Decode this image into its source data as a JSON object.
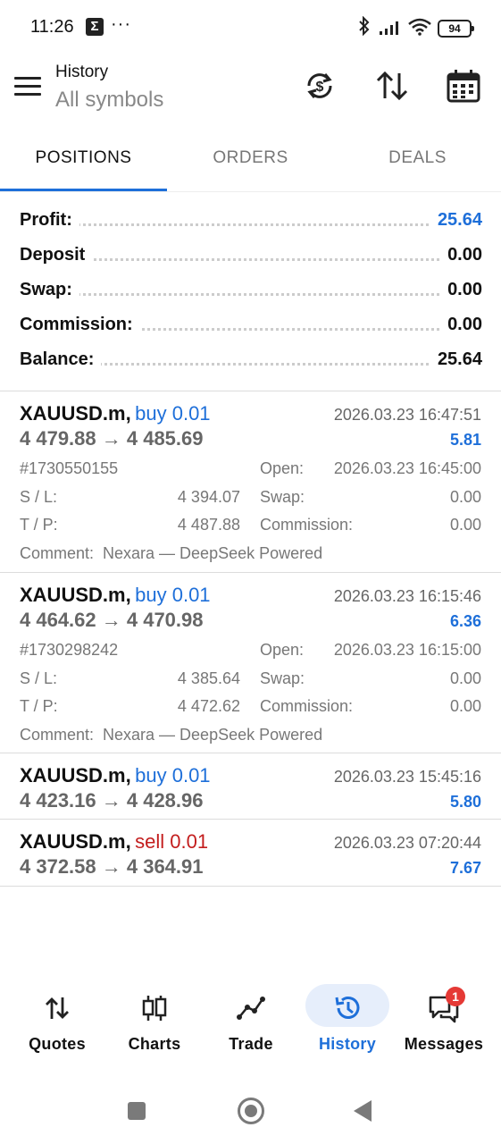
{
  "status_bar": {
    "time": "11:26",
    "more": "···",
    "battery": "94"
  },
  "header": {
    "title": "History",
    "subtitle": "All symbols"
  },
  "tabs": [
    {
      "label": "POSITIONS",
      "active": true
    },
    {
      "label": "ORDERS",
      "active": false
    },
    {
      "label": "DEALS",
      "active": false
    }
  ],
  "summary": [
    {
      "label": "Profit:",
      "value": "25.64",
      "highlight": true
    },
    {
      "label": "Deposit",
      "value": "0.00",
      "highlight": false
    },
    {
      "label": "Swap:",
      "value": "0.00",
      "highlight": false
    },
    {
      "label": "Commission:",
      "value": "0.00",
      "highlight": false
    },
    {
      "label": "Balance:",
      "value": "25.64",
      "highlight": false
    }
  ],
  "positions": [
    {
      "symbol": "XAUUSD.m,",
      "type": "buy 0.01",
      "side": "buy",
      "close_time": "2026.03.23 16:47:51",
      "prices": "4 479.88 → 4 485.69",
      "profit": "5.81",
      "details": {
        "id": "#1730550155",
        "open_label": "Open:",
        "open_time": "2026.03.23 16:45:00",
        "sl_label": "S / L:",
        "sl": "4 394.07",
        "swap_label": "Swap:",
        "swap": "0.00",
        "tp_label": "T / P:",
        "tp": "4 487.88",
        "commission_label": "Commission:",
        "commission": "0.00",
        "comment": "Comment:  Nexara — DeepSeek Powered"
      }
    },
    {
      "symbol": "XAUUSD.m,",
      "type": "buy 0.01",
      "side": "buy",
      "close_time": "2026.03.23 16:15:46",
      "prices": "4 464.62 → 4 470.98",
      "profit": "6.36",
      "details": {
        "id": "#1730298242",
        "open_label": "Open:",
        "open_time": "2026.03.23 16:15:00",
        "sl_label": "S / L:",
        "sl": "4 385.64",
        "swap_label": "Swap:",
        "swap": "0.00",
        "tp_label": "T / P:",
        "tp": "4 472.62",
        "commission_label": "Commission:",
        "commission": "0.00",
        "comment": "Comment:  Nexara — DeepSeek Powered"
      }
    },
    {
      "symbol": "XAUUSD.m,",
      "type": "buy 0.01",
      "side": "buy",
      "close_time": "2026.03.23 15:45:16",
      "prices": "4 423.16 → 4 428.96",
      "profit": "5.80"
    },
    {
      "symbol": "XAUUSD.m,",
      "type": "sell 0.01",
      "side": "sell",
      "close_time": "2026.03.23 07:20:44",
      "prices": "4 372.58 → 4 364.91",
      "profit": "7.67"
    }
  ],
  "bottom_nav": [
    {
      "label": "Quotes",
      "icon": "quotes-icon",
      "active": false
    },
    {
      "label": "Charts",
      "icon": "candlestick-icon",
      "active": false
    },
    {
      "label": "Trade",
      "icon": "trade-line-icon",
      "active": false
    },
    {
      "label": "History",
      "icon": "history-icon",
      "active": true
    },
    {
      "label": "Messages",
      "icon": "messages-icon",
      "active": false,
      "badge": "1"
    }
  ],
  "colors": {
    "accent": "#1e6fd9",
    "sell": "#c31d1d",
    "badge": "#e53935",
    "active_nav_bg": "#e6eefb"
  }
}
